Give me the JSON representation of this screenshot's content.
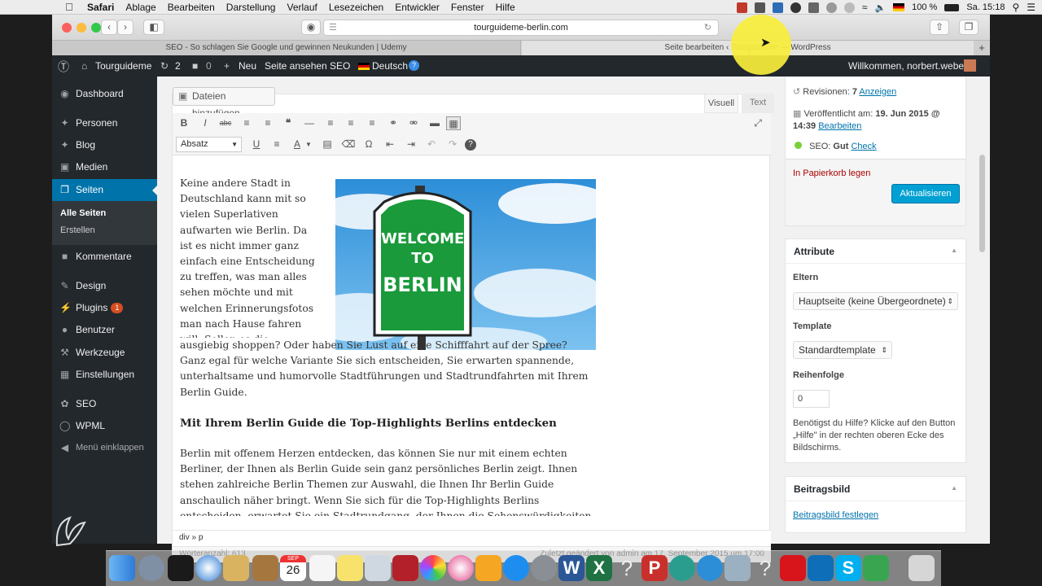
{
  "menubar": {
    "app": "Safari",
    "menus": [
      "Ablage",
      "Bearbeiten",
      "Darstellung",
      "Verlauf",
      "Lesezeichen",
      "Entwickler",
      "Fenster",
      "Hilfe"
    ],
    "battery": "100 %",
    "clock": "Sa. 15:18"
  },
  "browser": {
    "url": "tourguideme-berlin.com",
    "tabs": [
      {
        "label": "SEO - So schlagen Sie Google und gewinnen Neukunden | Udemy"
      },
      {
        "label": "Seite bearbeiten ‹ Tourguideme — WordPress"
      }
    ]
  },
  "adminbar": {
    "site": "Tourguideme",
    "updates": "2",
    "comments": "0",
    "new": "Neu",
    "view": "Seite ansehen",
    "seo": "SEO",
    "language": "Deutsch",
    "welcome": "Willkommen, norbert.weber"
  },
  "sidebar": {
    "items": [
      "Dashboard",
      "Personen",
      "Blog",
      "Medien",
      "Seiten",
      "Kommentare",
      "Design",
      "Plugins",
      "Benutzer",
      "Werkzeuge",
      "Einstellungen",
      "SEO",
      "WPML",
      "Menü einklappen"
    ],
    "plugins_badge": "1",
    "sub": [
      "Alle Seiten",
      "Erstellen"
    ]
  },
  "editor": {
    "add_media": "Dateien hinzufügen",
    "tab_visual": "Visuell",
    "tab_text": "Text",
    "format": "Absatz",
    "image_line1": "WELCOME",
    "image_line2": "TO",
    "image_line3": "BERLIN",
    "para1": "Keine andere Stadt in Deutschland kann mit so vielen Superlativen aufwarten wie Berlin. Da ist es nicht immer ganz einfach eine Entscheidung zu treffen, was man alles sehen möchte und mit welchen Erinnerungsfotos man nach Hause fahren will. Sollen es die Highlights der Metropole sein? Möchten Sie",
    "para1b": "ausgiebig shoppen? Oder haben Sie Lust auf eine Schifffahrt auf der Spree? Ganz egal für welche Variante Sie sich entscheiden, Sie erwarten spannende, unterhaltsame und humorvolle Stadtführungen und Stadtrundfahrten mit Ihrem Berlin Guide.",
    "heading": "Mit Ihrem Berlin Guide die Top-Highlights Berlins entdecken",
    "para2": "Berlin mit offenem Herzen entdecken, das können Sie nur mit einem echten Berliner, der Ihnen als Berlin Guide sein ganz persönliches Berlin zeigt. Ihnen stehen zahlreiche Berlin Themen zur Auswahl, die Ihnen Ihr Berlin Guide anschaulich näher bringt. Wenn Sie sich für die Top-Highlights Berlins entscheiden, erwartet Sie ein Stadtrundgang, der Ihnen die Sehenswürdigkeiten auch wirklich persönlich näher bringt.",
    "path": "div » p",
    "wordcount": "Wörteranzahl: 613",
    "last_edit": "Zuletzt geändert von admin am 17. September 2015 um 17:00"
  },
  "publish": {
    "revisions_label": "Revisionen:",
    "revisions_count": "7",
    "revisions_link": "Anzeigen",
    "published_label": "Veröffentlicht am:",
    "published_date": "19. Jun 2015 @ 14:39",
    "published_link": "Bearbeiten",
    "seo_label": "SEO:",
    "seo_value": "Gut",
    "seo_link": "Check",
    "trash": "In Papierkorb legen",
    "update": "Aktualisieren"
  },
  "attributes": {
    "title": "Attribute",
    "parent_label": "Eltern",
    "parent_value": "Hauptseite (keine Übergeordnete)",
    "template_label": "Template",
    "template_value": "Standardtemplate",
    "order_label": "Reihenfolge",
    "order_value": "0",
    "help": "Benötigst du Hilfe? Klicke auf den Button „Hilfe\" in der rechten oberen Ecke des Bildschirms."
  },
  "featured": {
    "title": "Beitragsbild",
    "link": "Beitragsbild festlegen"
  },
  "dock": {
    "calendar_month": "SEP",
    "calendar_day": "26"
  },
  "colors": {
    "wp_dark": "#23282d",
    "wp_blue": "#0073aa",
    "button_blue": "#00a0d2",
    "badge": "#d54e21",
    "highlight": "#f8ee3c"
  }
}
